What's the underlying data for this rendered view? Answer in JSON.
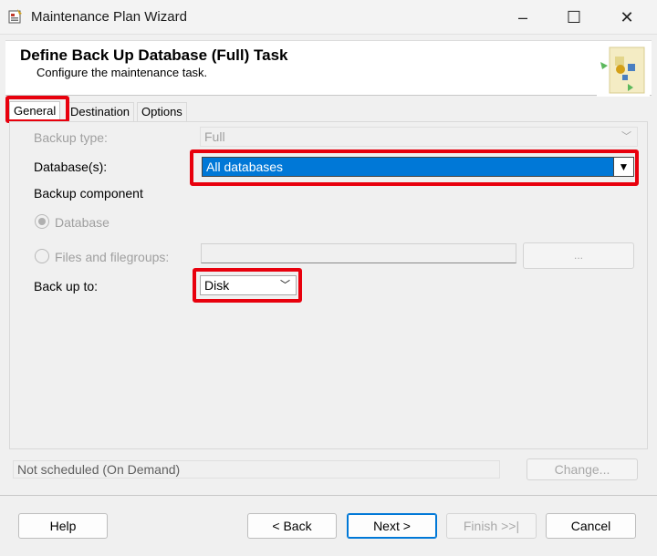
{
  "window": {
    "title": "Maintenance Plan Wizard",
    "icon": "wizard-app-icon",
    "controls": {
      "minimize": "–",
      "maximize": "☐",
      "close": "✕"
    }
  },
  "header": {
    "title": "Define Back Up Database (Full) Task",
    "subtitle": "Configure the maintenance task."
  },
  "tabs": [
    {
      "label": "General",
      "active": true
    },
    {
      "label": "Destination",
      "active": false
    },
    {
      "label": "Options",
      "active": false
    }
  ],
  "general": {
    "backup_type": {
      "label": "Backup type:",
      "value": "Full",
      "enabled": false
    },
    "databases": {
      "label": "Database(s):",
      "value": "All databases"
    },
    "backup_component": {
      "label": "Backup component"
    },
    "radio_database": {
      "label": "Database",
      "checked": true,
      "enabled": false
    },
    "radio_files": {
      "label": "Files and filegroups:",
      "checked": false,
      "enabled": false
    },
    "browse_button": {
      "label": "..."
    },
    "back_up_to": {
      "label": "Back up to:",
      "value": "Disk"
    }
  },
  "schedule": {
    "status": "Not scheduled (On Demand)",
    "change_label": "Change..."
  },
  "footer": {
    "help": "Help",
    "back": "< Back",
    "next": "Next >",
    "finish": "Finish >>|",
    "cancel": "Cancel"
  },
  "colors": {
    "highlight": "#e8000d",
    "selection": "#0078d7"
  }
}
